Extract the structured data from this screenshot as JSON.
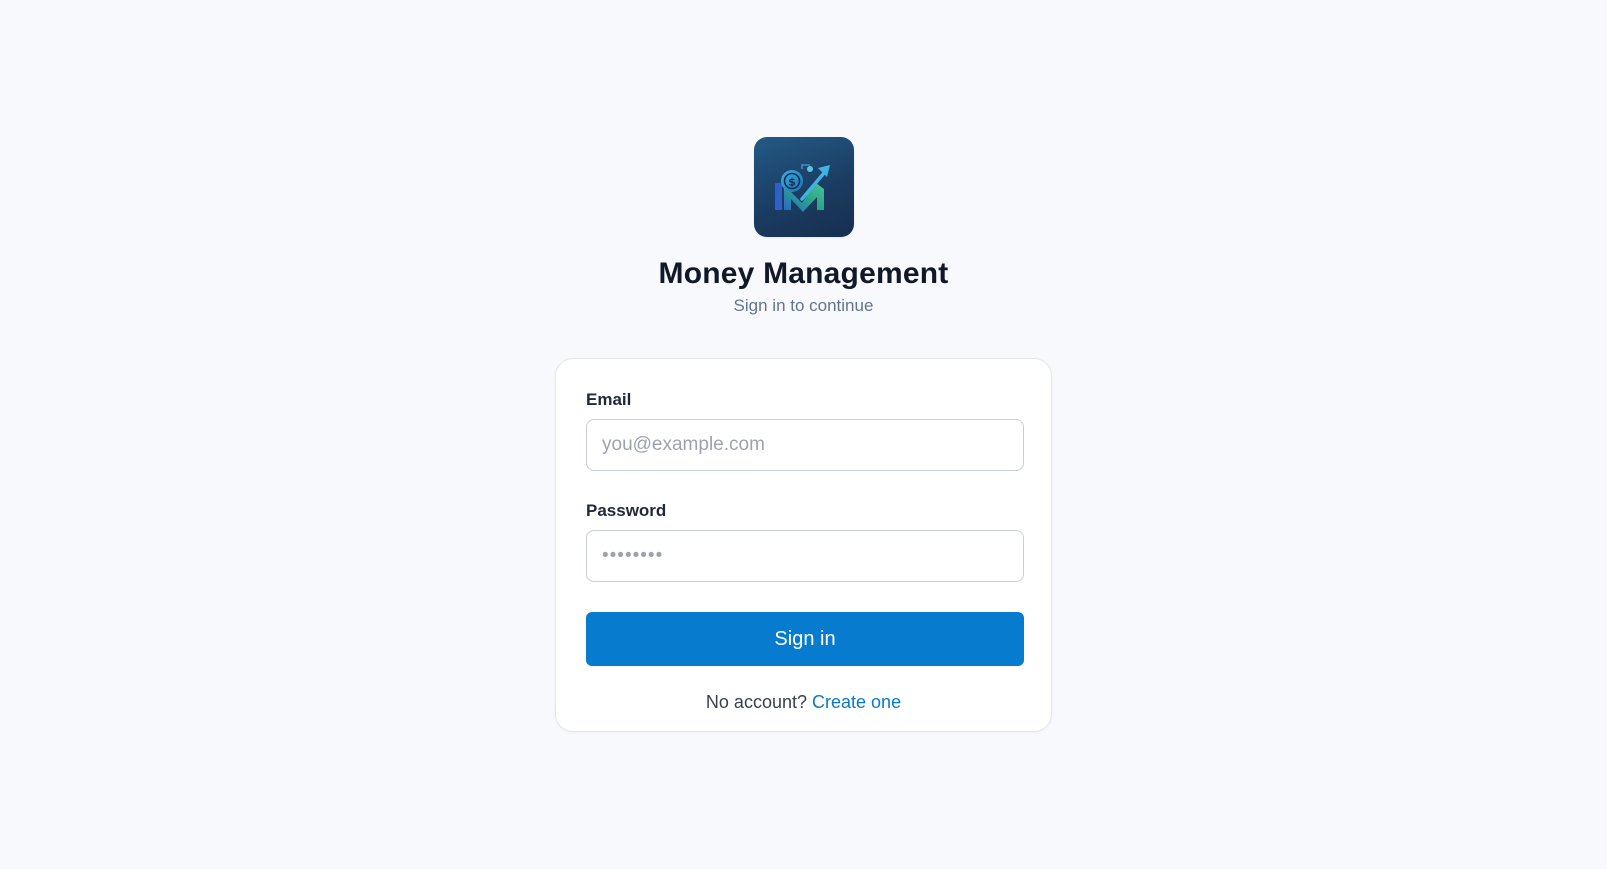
{
  "app": {
    "title": "Money Management",
    "subtitle": "Sign in to continue",
    "logo_icon": "money-management-logo-icon"
  },
  "form": {
    "email_label": "Email",
    "email_placeholder": "you@example.com",
    "email_value": "",
    "password_label": "Password",
    "password_placeholder": "••••••••",
    "password_value": "",
    "submit_label": "Sign in"
  },
  "footer": {
    "prompt": "No account?",
    "link_label": "Create one"
  },
  "colors": {
    "background": "#f8f9fd",
    "accent": "#077cce",
    "link": "#0b79c9",
    "logo_bg": "#1b3d63"
  }
}
